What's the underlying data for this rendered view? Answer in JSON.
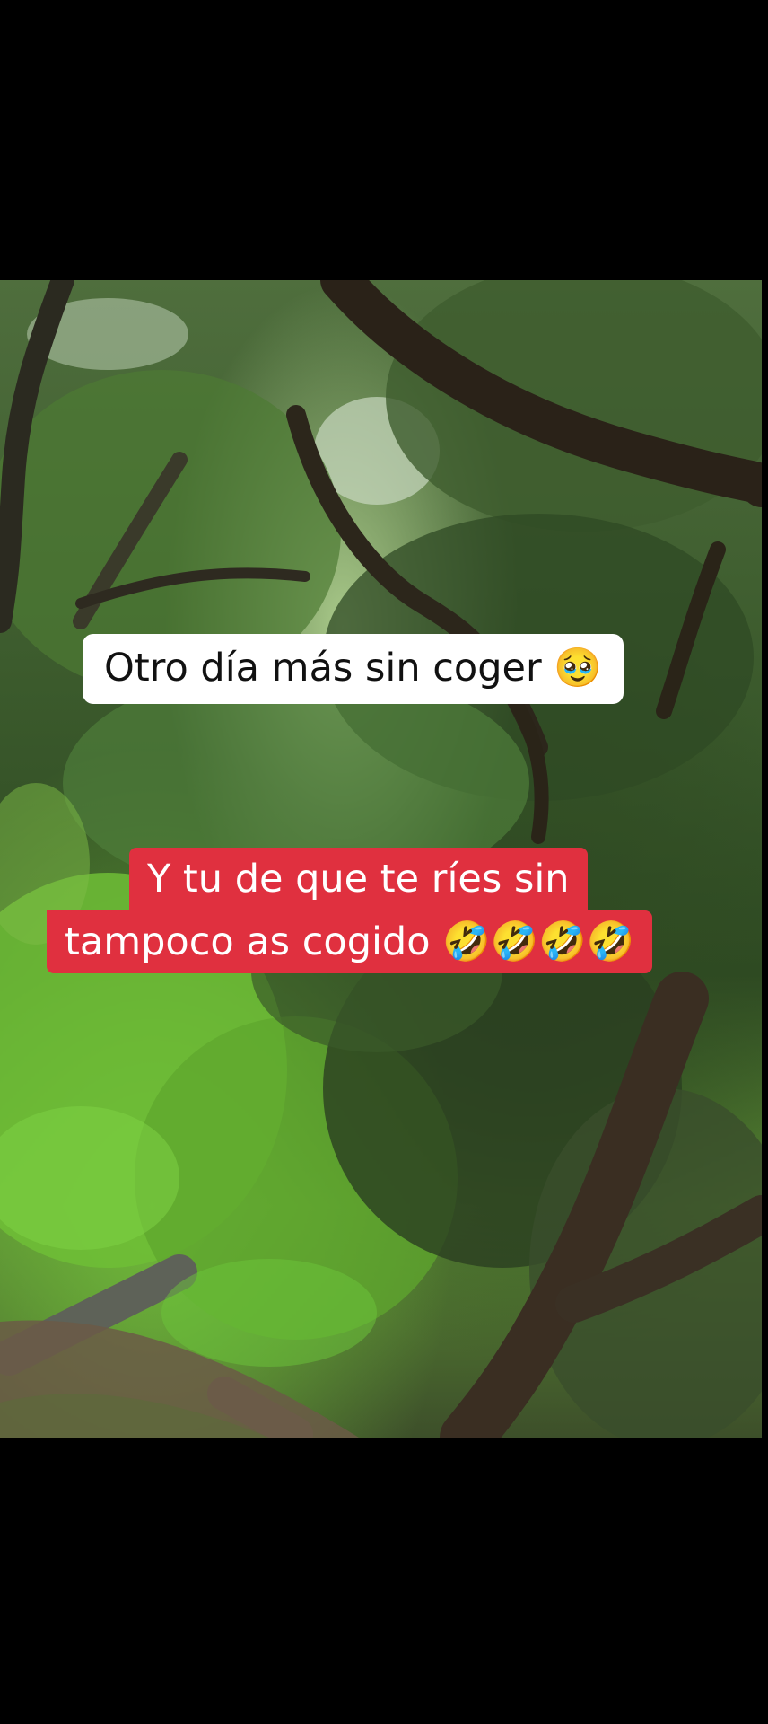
{
  "video": {
    "caption_top": "Otro día más sin coger 🥹",
    "caption_bottom_line1": "Y tu de que te ríes sin",
    "caption_bottom_line2": "tampoco as cogido 🤣🤣🤣🤣"
  }
}
